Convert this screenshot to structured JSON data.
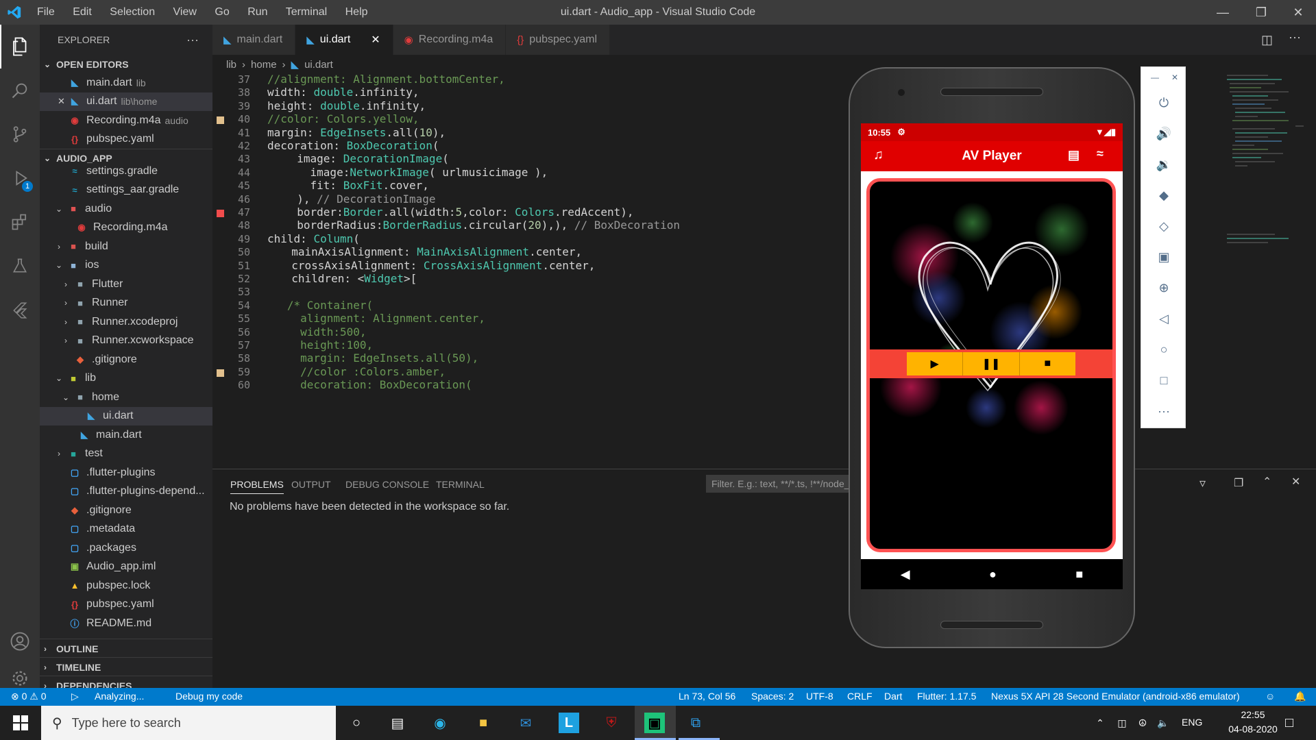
{
  "titlebar": {
    "menu": [
      "File",
      "Edit",
      "Selection",
      "View",
      "Go",
      "Run",
      "Terminal",
      "Help"
    ],
    "title": "ui.dart - Audio_app - Visual Studio Code"
  },
  "sidebar": {
    "header": "EXPLORER",
    "open_editors_label": "OPEN EDITORS",
    "open_editors": [
      {
        "name": "main.dart",
        "extra": "lib"
      },
      {
        "name": "ui.dart",
        "extra": "lib\\home"
      },
      {
        "name": "Recording.m4a",
        "extra": "audio"
      },
      {
        "name": "pubspec.yaml",
        "extra": ""
      }
    ],
    "project_label": "AUDIO_APP",
    "tree": [
      "settings.gradle",
      "settings_aar.gradle",
      "audio",
      "Recording.m4a",
      "build",
      "ios",
      "Flutter",
      "Runner",
      "Runner.xcodeproj",
      "Runner.xcworkspace",
      ".gitignore",
      "lib",
      "home",
      "ui.dart",
      "main.dart",
      "test",
      ".flutter-plugins",
      ".flutter-plugins-depend...",
      ".gitignore",
      ".metadata",
      ".packages",
      "Audio_app.iml",
      "pubspec.lock",
      "pubspec.yaml",
      "README.md"
    ],
    "outline_label": "OUTLINE",
    "timeline_label": "TIMELINE",
    "dependencies_label": "DEPENDENCIES"
  },
  "tabs": [
    "main.dart",
    "ui.dart",
    "Recording.m4a",
    "pubspec.yaml"
  ],
  "breadcrumb": [
    "lib",
    "home",
    "ui.dart"
  ],
  "editor": {
    "line_numbers": [
      "37",
      "38",
      "39",
      "40",
      "41",
      "42",
      "43",
      "44",
      "45",
      "46",
      "47",
      "48",
      "49",
      "50",
      "51",
      "52",
      "53",
      "54",
      "55",
      "56",
      "57",
      "58",
      "59",
      "60"
    ]
  },
  "panel": {
    "tabs": [
      "PROBLEMS",
      "OUTPUT",
      "DEBUG CONSOLE",
      "TERMINAL"
    ],
    "filter_placeholder": "Filter. E.g.: text, **/*.ts, !**/node_modules/**",
    "message": "No problems have been detected in the workspace so far."
  },
  "statusbar": {
    "errors": "⊗ 0 ⚠ 0",
    "analyzing": "Analyzing...",
    "debug": "Debug my code",
    "position": "Ln 73, Col 56",
    "spaces": "Spaces: 2",
    "encoding": "UTF-8",
    "eol": "CRLF",
    "language": "Dart",
    "flutter": "Flutter: 1.17.5",
    "device": "Nexus 5X API 28 Second Emulator (android-x86 emulator)"
  },
  "taskbar": {
    "search_placeholder": "Type here to search",
    "lang": "ENG",
    "time": "22:55",
    "date": "04-08-2020"
  },
  "phone": {
    "time": "10:55",
    "app_title": "AV Player"
  },
  "colors": {
    "accent": "#007acc",
    "app_bar": "#e00000",
    "border": "#ff5252",
    "controls": "#ffb300"
  }
}
